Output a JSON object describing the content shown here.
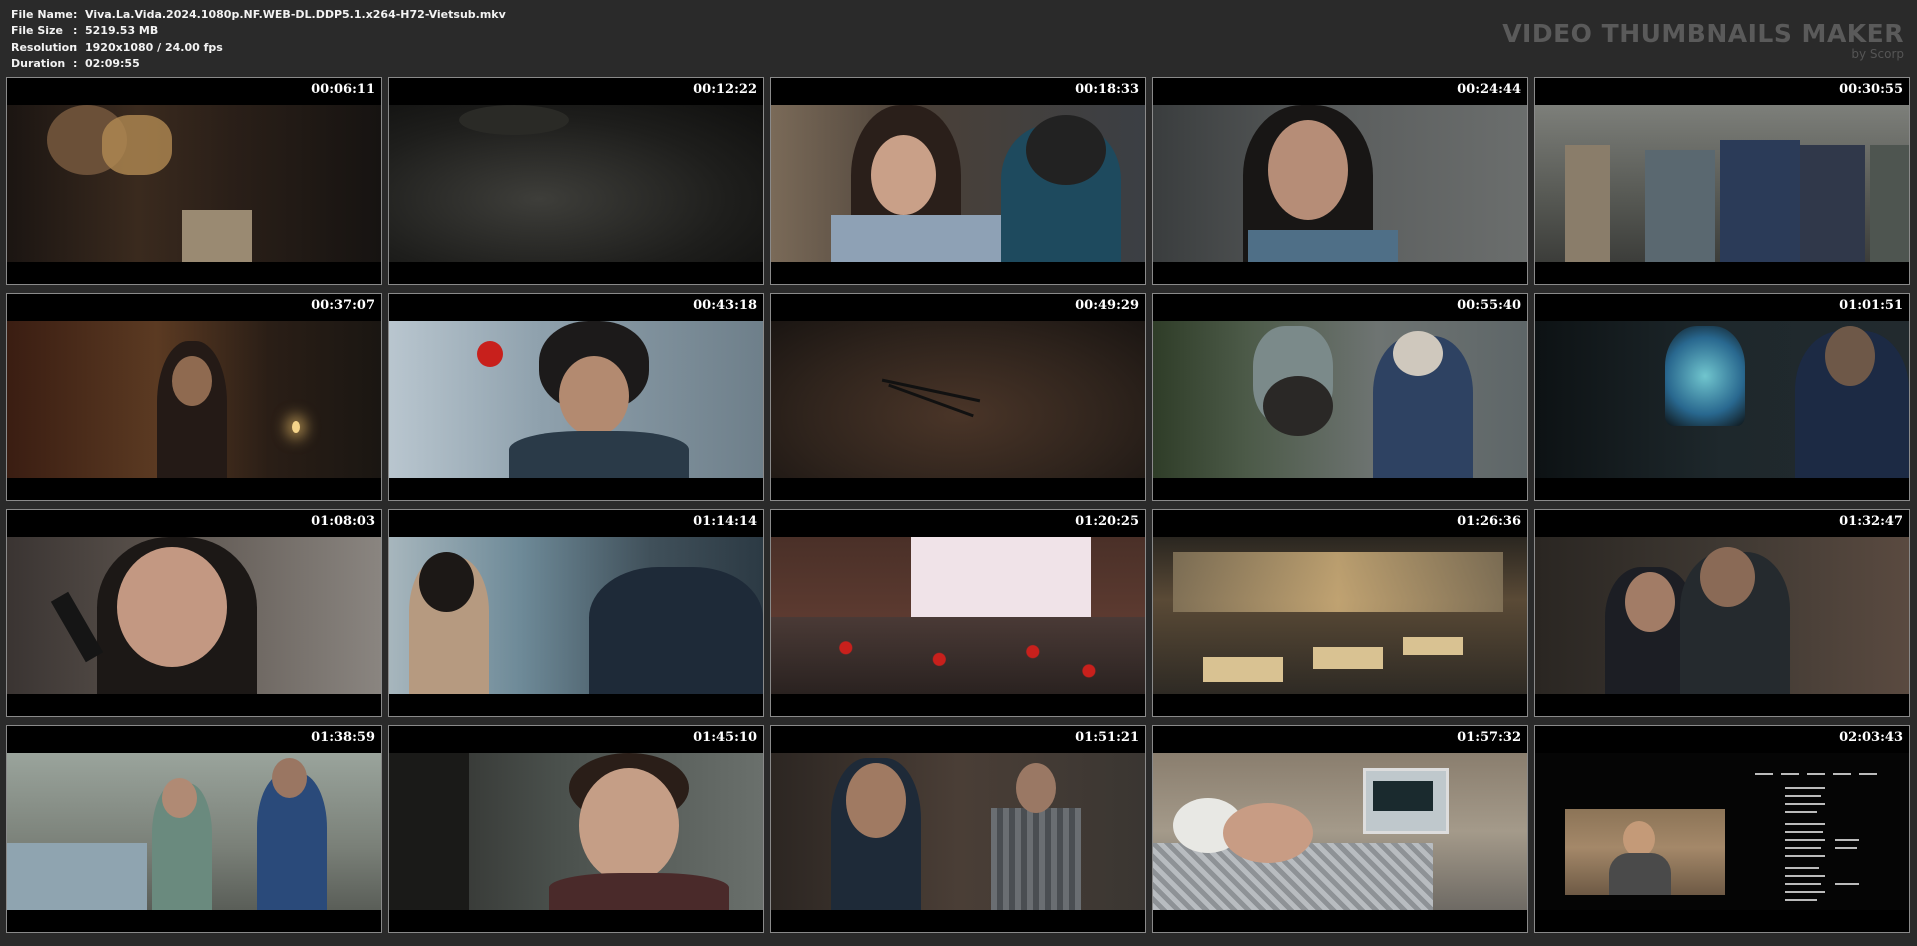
{
  "info": {
    "rows": [
      {
        "key": "File Name",
        "sep": ":",
        "value": "Viva.La.Vida.2024.1080p.NF.WEB-DL.DDP5.1.x264-H72-Vietsub.mkv"
      },
      {
        "key": "File Size",
        "sep": ":",
        "value": "5219.53 MB"
      },
      {
        "key": "Resolution",
        "sep": ":",
        "value": "1920x1080 / 24.00 fps"
      },
      {
        "key": "Duration",
        "sep": ":",
        "value": "02:09:55"
      }
    ]
  },
  "brand": {
    "title": "VIDEO THUMBNAILS MAKER",
    "subtitle": "by Scorp"
  },
  "thumbnails": [
    {
      "time": "00:06:11"
    },
    {
      "time": "00:12:22"
    },
    {
      "time": "00:18:33"
    },
    {
      "time": "00:24:44"
    },
    {
      "time": "00:30:55"
    },
    {
      "time": "00:37:07"
    },
    {
      "time": "00:43:18"
    },
    {
      "time": "00:49:29"
    },
    {
      "time": "00:55:40"
    },
    {
      "time": "01:01:51"
    },
    {
      "time": "01:08:03"
    },
    {
      "time": "01:14:14"
    },
    {
      "time": "01:20:25"
    },
    {
      "time": "01:26:36"
    },
    {
      "time": "01:32:47"
    },
    {
      "time": "01:38:59"
    },
    {
      "time": "01:45:10"
    },
    {
      "time": "01:51:21"
    },
    {
      "time": "01:57:32"
    },
    {
      "time": "02:03:43"
    }
  ],
  "colors": {
    "background": "#2a2a2a",
    "brand": "#5a5a5a",
    "border": "#8a8a8a"
  }
}
